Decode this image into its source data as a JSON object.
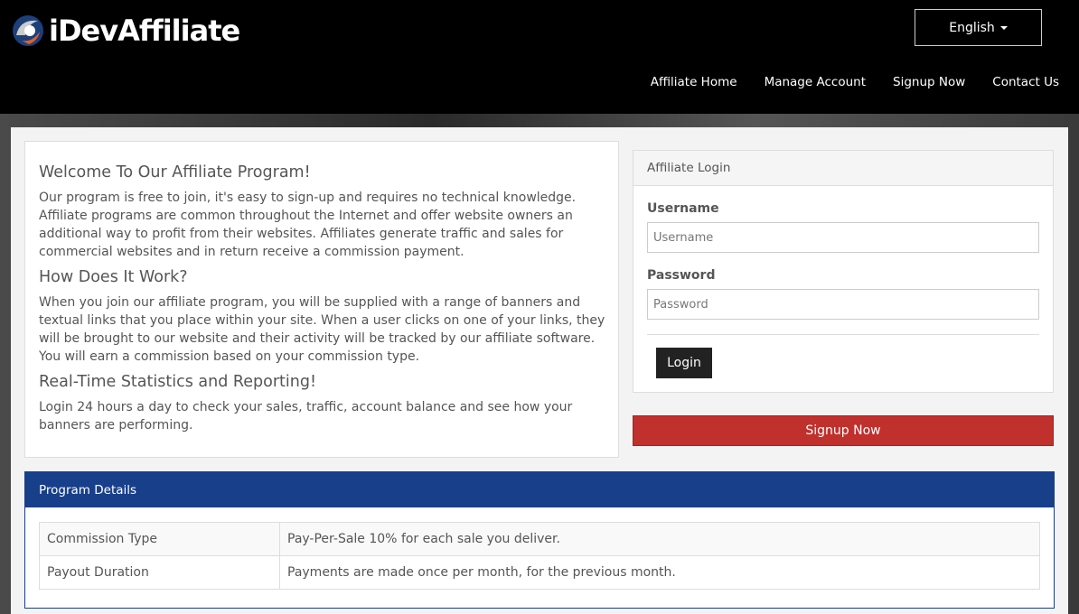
{
  "brand": {
    "name": "iDevAffiliate"
  },
  "language": {
    "selected": "English"
  },
  "nav": {
    "items": [
      "Affiliate Home",
      "Manage Account",
      "Signup Now",
      "Contact Us"
    ]
  },
  "welcome": {
    "sections": [
      {
        "heading": "Welcome To Our Affiliate Program!",
        "text": "Our program is free to join, it's easy to sign-up and requires no technical knowledge. Affiliate programs are common throughout the Internet and offer website owners an additional way to profit from their websites. Affiliates generate traffic and sales for commercial websites and in return receive a commission payment."
      },
      {
        "heading": "How Does It Work?",
        "text": "When you join our affiliate program, you will be supplied with a range of banners and textual links that you place within your site. When a user clicks on one of your links, they will be brought to our website and their activity will be tracked by our affiliate software. You will earn a commission based on your commission type."
      },
      {
        "heading": "Real-Time Statistics and Reporting!",
        "text": "Login 24 hours a day to check your sales, traffic, account balance and see how your banners are performing."
      }
    ]
  },
  "login": {
    "title": "Affiliate Login",
    "username_label": "Username",
    "username_placeholder": "Username",
    "password_label": "Password",
    "password_placeholder": "Password",
    "button": "Login"
  },
  "signup": {
    "button": "Signup Now"
  },
  "program": {
    "title": "Program Details",
    "rows": [
      {
        "key": "Commission Type",
        "value": "Pay-Per-Sale 10% for each sale you deliver."
      },
      {
        "key": "Payout Duration",
        "value": "Payments are made once per month, for the previous month."
      }
    ]
  },
  "colors": {
    "header_bg": "#000000",
    "program_blue": "#183f8a",
    "signup_red": "#c0302d"
  }
}
